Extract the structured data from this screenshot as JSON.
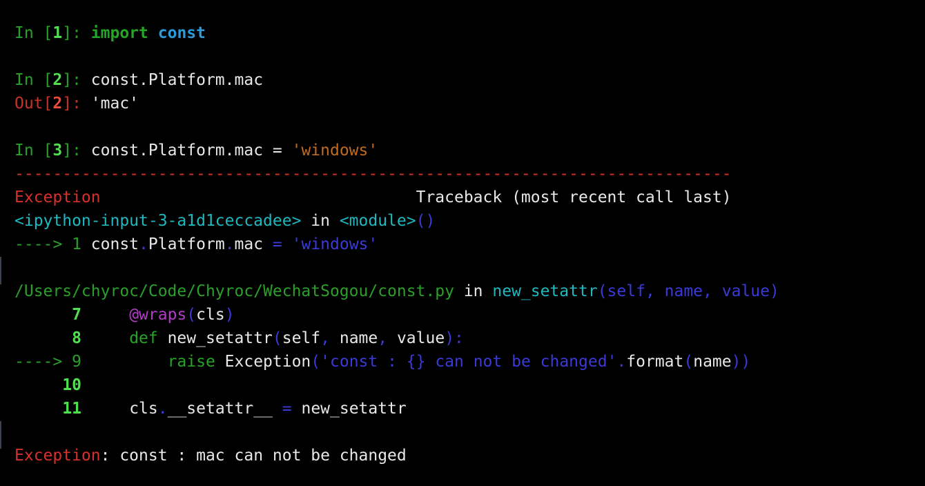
{
  "colors": {
    "background": "#000000",
    "prompt_in": "#2aa02a",
    "prompt_out": "#c8322a",
    "keyword": "#25a525",
    "module": "#2a9cdb",
    "string": "#c06b20",
    "error": "#d8302a",
    "cyan": "#1fb8c0",
    "blue": "#3a3ad8",
    "text": "#e8e8e8"
  },
  "cell1": {
    "prompt_in": "In [",
    "num": "1",
    "prompt_close": "]: ",
    "kw": "import",
    "module": "const"
  },
  "cell2": {
    "prompt_in": "In [",
    "num": "2",
    "prompt_close": "]: ",
    "code": "const.Platform.mac",
    "out_prompt": "Out[",
    "out_num": "2",
    "out_close": "]: ",
    "out_value": "'mac'"
  },
  "cell3": {
    "prompt_in": "In [",
    "num": "3",
    "prompt_close": "]: ",
    "code": "const.Platform.mac = ",
    "string": "'windows'"
  },
  "traceback": {
    "separator": "---------------------------------------------------------------------------",
    "exception_name": "Exception",
    "header_right": "Traceback (most recent call last)",
    "frame1": {
      "file": "<ipython-input-3-a1d1ceccadee>",
      "in": " in ",
      "func": "<module>",
      "parens": "()",
      "arrow": "----> 1 ",
      "code_a": "const",
      "dot1": ".",
      "code_b": "Platform",
      "dot2": ".",
      "code_c": "mac",
      "eq": " = ",
      "string": "'windows'"
    },
    "frame2": {
      "file": "/Users/chyroc/Code/Chyroc/WechatSogou/const.py",
      "in": " in ",
      "func": "new_setattr",
      "args": "(self, name, value)",
      "lines": [
        {
          "gutter": "      7",
          "indent": "     ",
          "parts": [
            [
              "@wraps",
              "c-purple"
            ],
            [
              "(",
              "c-blue"
            ],
            [
              "cls",
              "c-white"
            ],
            [
              ")",
              "c-blue"
            ]
          ]
        },
        {
          "gutter": "      8",
          "indent": "     ",
          "parts": [
            [
              "def",
              "c-kwnorm"
            ],
            [
              " new_setattr",
              "c-white"
            ],
            [
              "(",
              "c-blue"
            ],
            [
              "self",
              "c-white"
            ],
            [
              ", ",
              "c-blue"
            ],
            [
              "name",
              "c-white"
            ],
            [
              ", ",
              "c-blue"
            ],
            [
              "value",
              "c-white"
            ],
            [
              "):",
              "c-blue"
            ]
          ]
        },
        {
          "gutter": "----> 9",
          "indent": "         ",
          "parts": [
            [
              "raise",
              "c-kwnorm"
            ],
            [
              " Exception",
              "c-white"
            ],
            [
              "(",
              "c-blue"
            ],
            [
              "'const : {} can not be changed'",
              "c-blue"
            ],
            [
              ".",
              "c-blue"
            ],
            [
              "format",
              "c-white"
            ],
            [
              "(",
              "c-blue"
            ],
            [
              "name",
              "c-white"
            ],
            [
              "))",
              "c-blue"
            ]
          ]
        },
        {
          "gutter": "     10",
          "indent": "",
          "parts": []
        },
        {
          "gutter": "     11",
          "indent": "     ",
          "parts": [
            [
              "cls",
              "c-white"
            ],
            [
              ".",
              "c-blue"
            ],
            [
              "__setattr__",
              "c-white"
            ],
            [
              " = ",
              "c-blue"
            ],
            [
              "new_setattr",
              "c-white"
            ]
          ]
        }
      ]
    },
    "final": {
      "name": "Exception",
      "colon": ": ",
      "message": "const : mac can not be changed"
    }
  }
}
